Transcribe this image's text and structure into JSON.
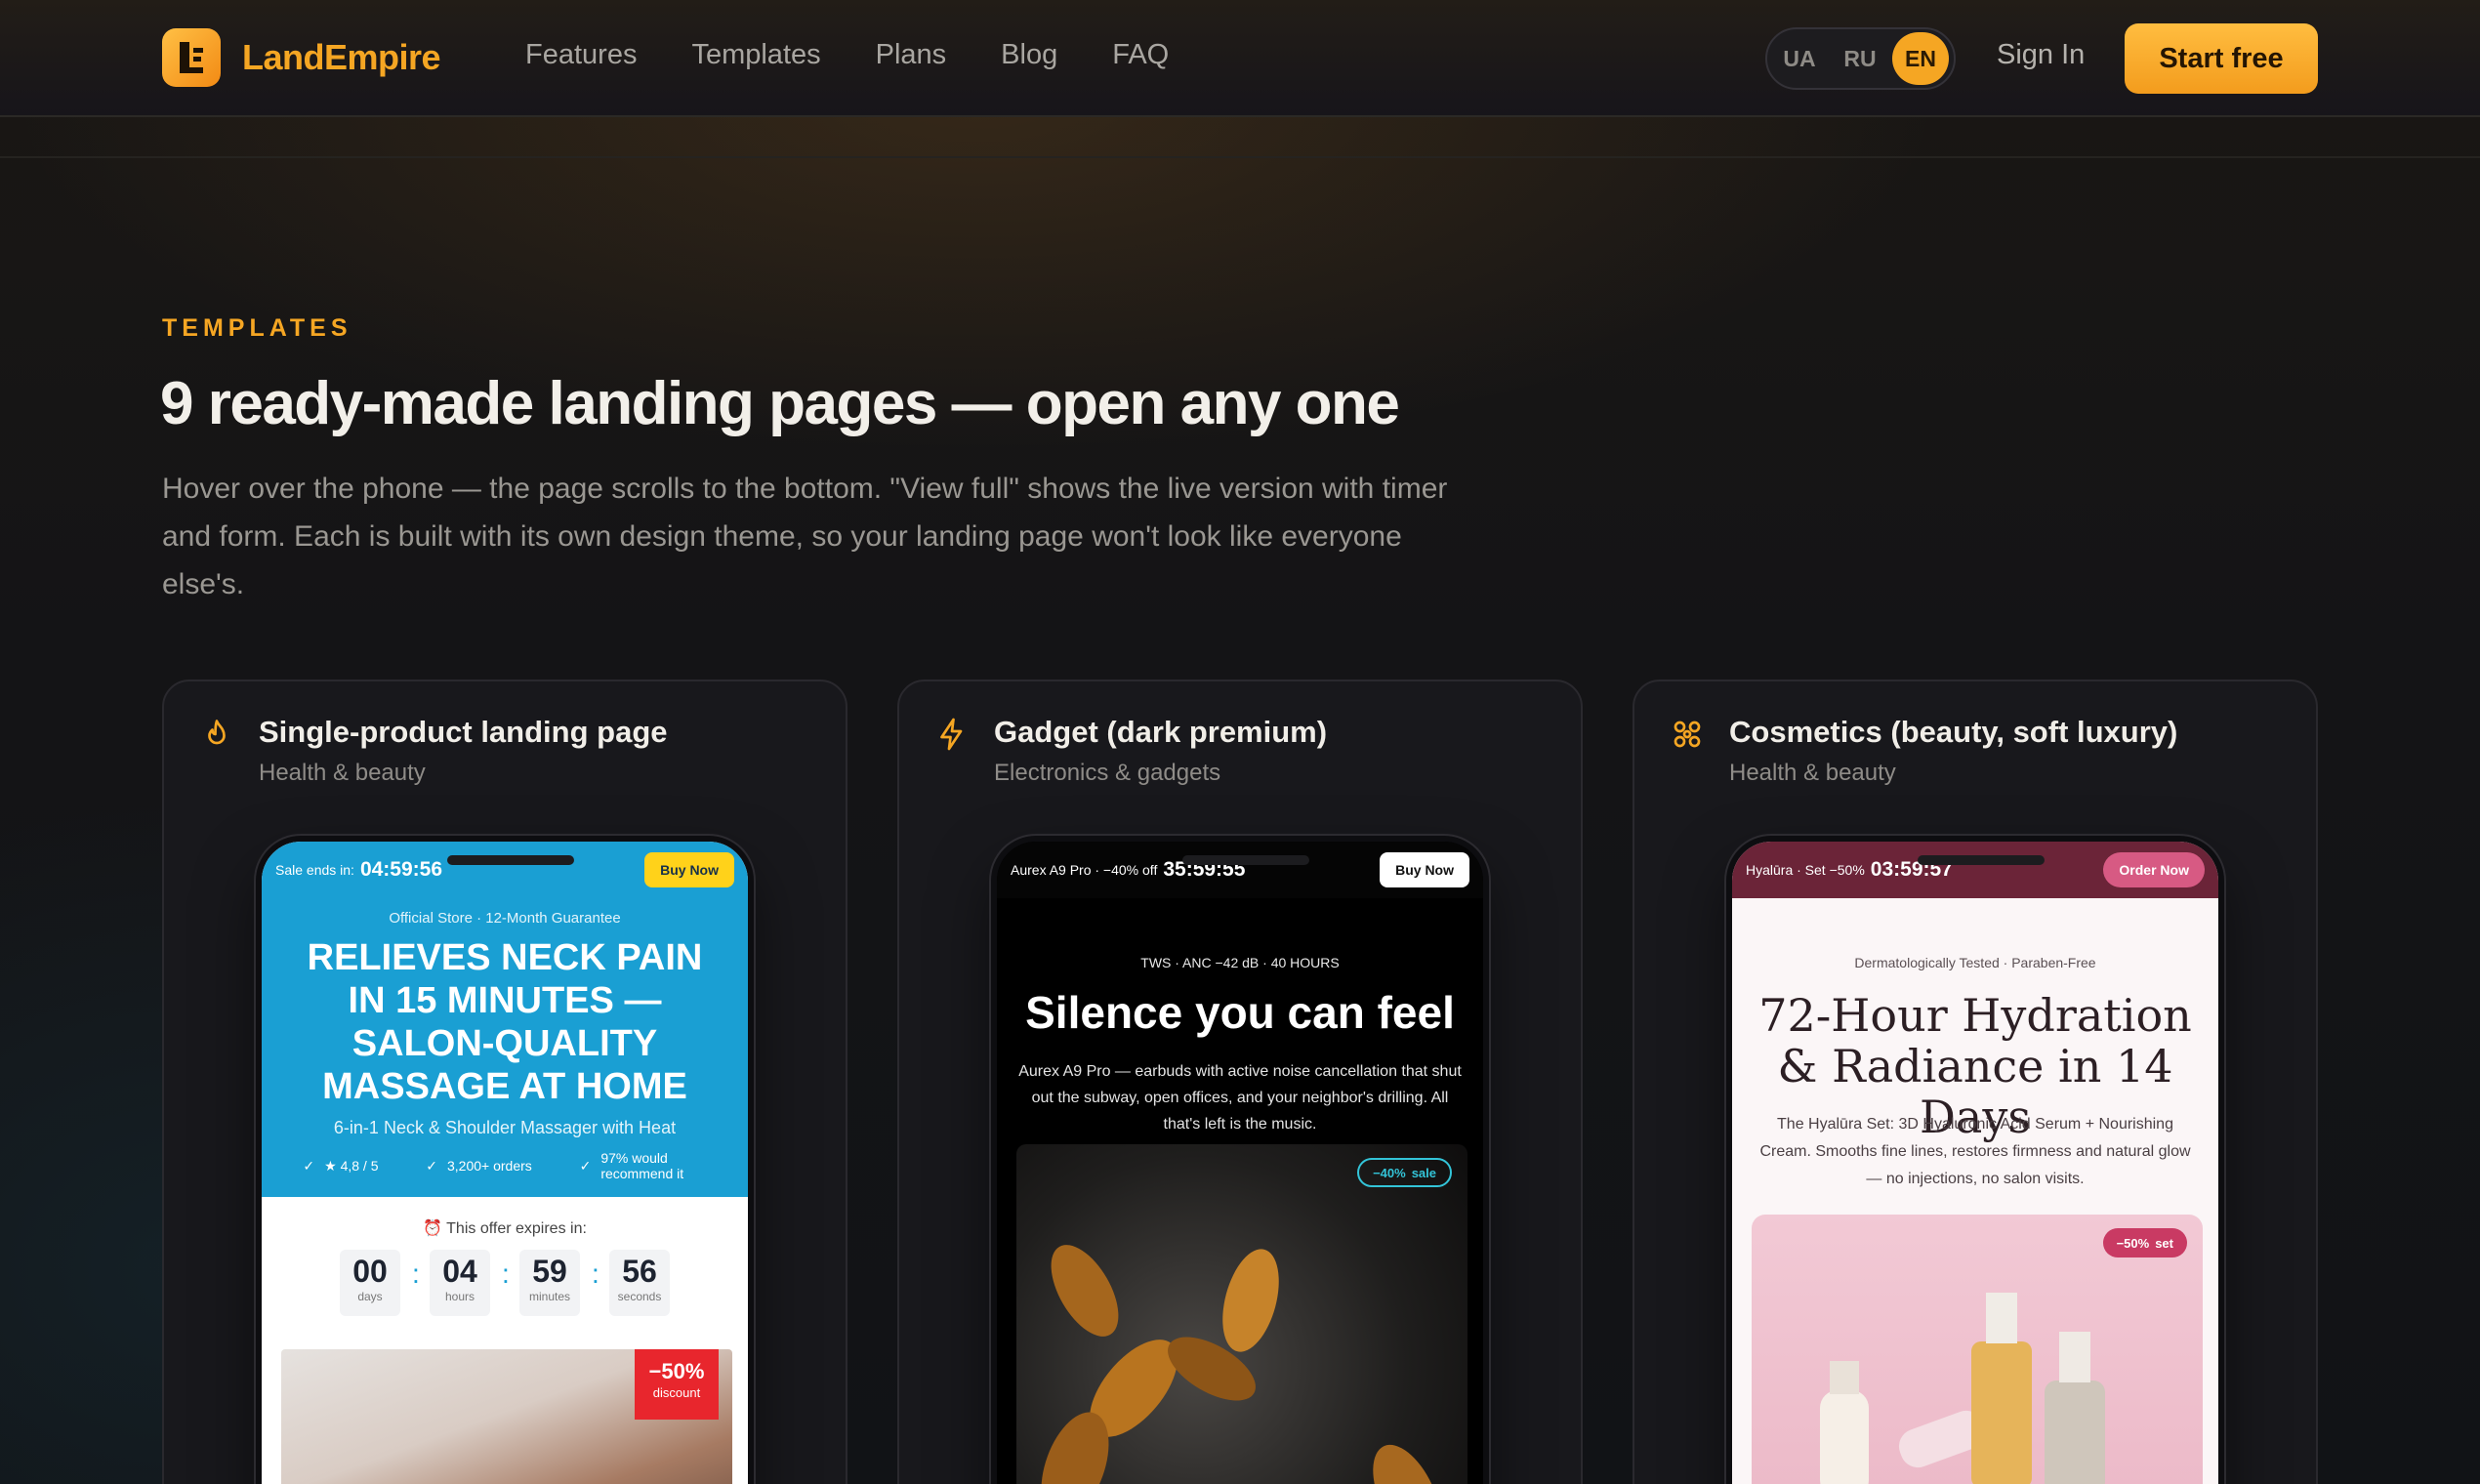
{
  "brand": {
    "name": "LandEmpire",
    "logo_letter": "L",
    "accent": "#f5a623"
  },
  "nav": {
    "links": [
      "Features",
      "Templates",
      "Plans",
      "Blog",
      "FAQ"
    ]
  },
  "languages": {
    "options": [
      "UA",
      "RU",
      "EN"
    ],
    "selected": "EN"
  },
  "header": {
    "sign_in": "Sign In",
    "start_free": "Start free"
  },
  "section": {
    "eyebrow": "TEMPLATES",
    "title": "9 ready-made landing pages — open any one",
    "lead": "Hover over the phone — the page scrolls to the bottom. \"View full\" shows the live version with timer and form. Each is built with its own design theme, so your landing page won't look like everyone else's."
  },
  "cards": [
    {
      "icon": "flame-icon",
      "title": "Single-product landing page",
      "category": "Health & beauty",
      "preview": {
        "bar_label": "Sale ends in:",
        "timer": "04:59:56",
        "button": "Buy Now",
        "official": "Official Store · 12-Month Guarantee",
        "headline": "RELIEVES NECK PAIN IN 15 MINUTES — SALON-QUALITY MASSAGE AT HOME",
        "subhead": "6-in-1 Neck & Shoulder Massager with Heat",
        "checks": [
          "★ 4,8 / 5",
          "3,200+ orders",
          "97% would recommend it"
        ],
        "expires": "⏰ This offer expires in:",
        "countdown": [
          {
            "value": "00",
            "unit": "days"
          },
          {
            "value": "04",
            "unit": "hours"
          },
          {
            "value": "59",
            "unit": "minutes"
          },
          {
            "value": "56",
            "unit": "seconds"
          }
        ],
        "badge": {
          "value": "−50%",
          "label": "discount"
        }
      }
    },
    {
      "icon": "bolt-icon",
      "title": "Gadget (dark premium)",
      "category": "Electronics & gadgets",
      "preview": {
        "bar_label": "Aurex A9 Pro · −40% off",
        "timer": "35:59:55",
        "button": "Buy Now",
        "kicker": "TWS · ANC −42 dB · 40 HOURS",
        "headline": "Silence you can feel",
        "description": "Aurex A9 Pro — earbuds with active noise cancellation that shut out the subway, open offices, and your neighbor's drilling. All that's left is the music.",
        "badge": {
          "value": "−40%",
          "label": "sale"
        }
      }
    },
    {
      "icon": "flower-icon",
      "title": "Cosmetics (beauty, soft luxury)",
      "category": "Health & beauty",
      "preview": {
        "bar_label": "Hyalūra · Set −50%",
        "timer": "03:59:57",
        "button": "Order Now",
        "kicker": "Dermatologically Tested · Paraben-Free",
        "headline": "72-Hour Hydration & Radiance in 14 Days",
        "description": "The Hyalūra Set: 3D Hyaluronic Acid Serum + Nourishing Cream. Smooths fine lines, restores firmness and natural glow — no injections, no salon visits.",
        "badge": {
          "value": "−50%",
          "label": "set"
        }
      }
    }
  ]
}
